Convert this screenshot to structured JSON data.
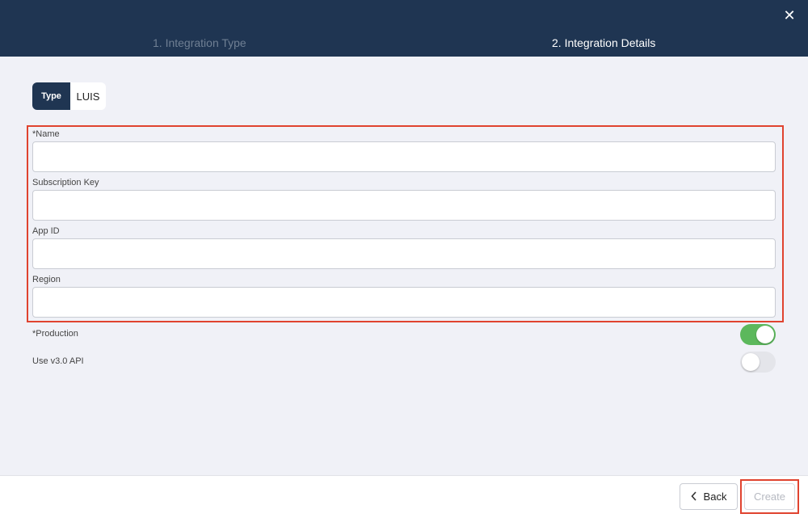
{
  "header": {
    "close_glyph": "✕",
    "steps": [
      {
        "label": "1. Integration Type",
        "active": false
      },
      {
        "label": "2. Integration Details",
        "active": true
      }
    ]
  },
  "type_selector": {
    "label": "Type",
    "value": "LUIS"
  },
  "form": {
    "fields": [
      {
        "label": "*Name",
        "value": "",
        "placeholder": ""
      },
      {
        "label": "Subscription Key",
        "value": "",
        "placeholder": ""
      },
      {
        "label": "App ID",
        "value": "",
        "placeholder": ""
      },
      {
        "label": "Region",
        "value": "",
        "placeholder": ""
      }
    ],
    "toggles": [
      {
        "label": "*Production",
        "on": true
      },
      {
        "label": "Use v3.0 API",
        "on": false
      }
    ]
  },
  "footer": {
    "back_label": "Back",
    "back_icon": "chevron-left-icon",
    "create_label": "Create",
    "create_enabled": false
  },
  "colors": {
    "header_bg": "#1f3552",
    "toggle_on": "#5cb85c",
    "highlight": "#e0432f"
  }
}
